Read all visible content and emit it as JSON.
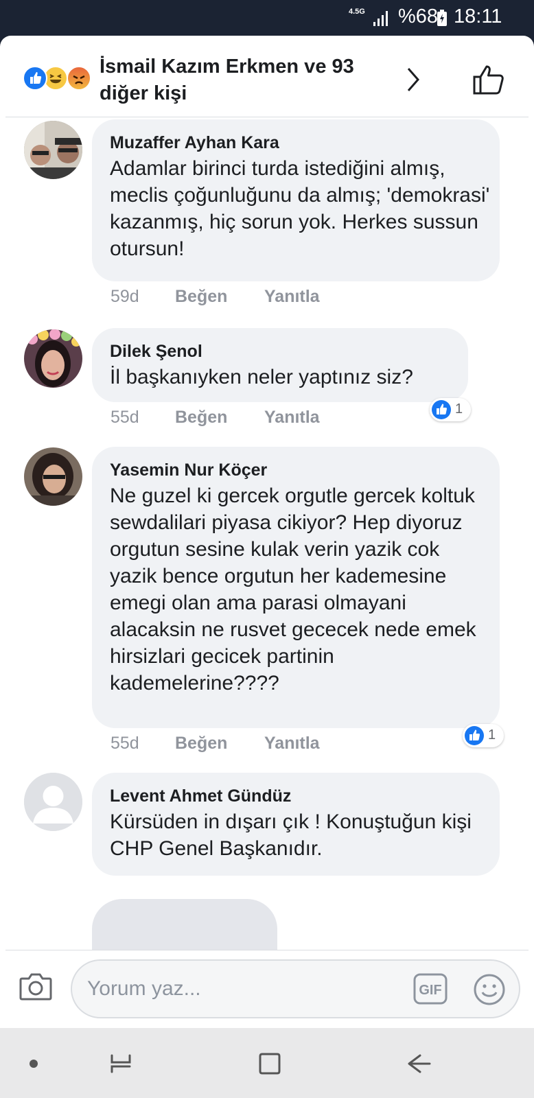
{
  "status_bar": {
    "network": "4.5G",
    "battery_percent": "%68",
    "time": "18:11"
  },
  "header": {
    "title": "İsmail Kazım Erkmen ve 93 diğer kişi",
    "reaction_icons": [
      "like-icon",
      "haha-icon",
      "angry-icon"
    ]
  },
  "comments": [
    {
      "author": "Muzaffer Ayhan Kara",
      "text": "Adamlar birinci turda istediğini almış, meclis çoğunluğunu da almış; 'demokrasi' kazanmış, hiç sorun yok. Herkes sussun otursun!",
      "time": "59d",
      "like_label": "Beğen",
      "reply_label": "Yanıtla"
    },
    {
      "author": "Dilek Şenol",
      "text": "İl başkanıyken neler yaptınız siz?",
      "time": "55d",
      "like_label": "Beğen",
      "reply_label": "Yanıtla",
      "reaction_count": "1"
    },
    {
      "author": "Yasemin Nur Köçer",
      "text": "Ne guzel ki gercek orgutle gercek koltuk sewdalilari piyasa cikiyor? Hep diyoruz orgutun sesine kulak verin yazik cok yazik bence orgutun her kademesine emegi olan ama parasi olmayani alacaksin ne rusvet gececek nede emek hirsizlari gecicek partinin kademelerine????",
      "time": "55d",
      "like_label": "Beğen",
      "reply_label": "Yanıtla",
      "reaction_count": "1"
    },
    {
      "author": "Levent Ahmet Gündüz",
      "text": "Kürsüden in dışarı çık ! Konuştuğun kişi CHP Genel Başkanıdır."
    }
  ],
  "composer": {
    "placeholder": "Yorum yaz...",
    "gif_label": "GIF"
  },
  "colors": {
    "brand_blue": "#1877f2",
    "bubble": "#f0f2f5",
    "status_bar": "#1b2333",
    "meta_gray": "#90949c"
  }
}
